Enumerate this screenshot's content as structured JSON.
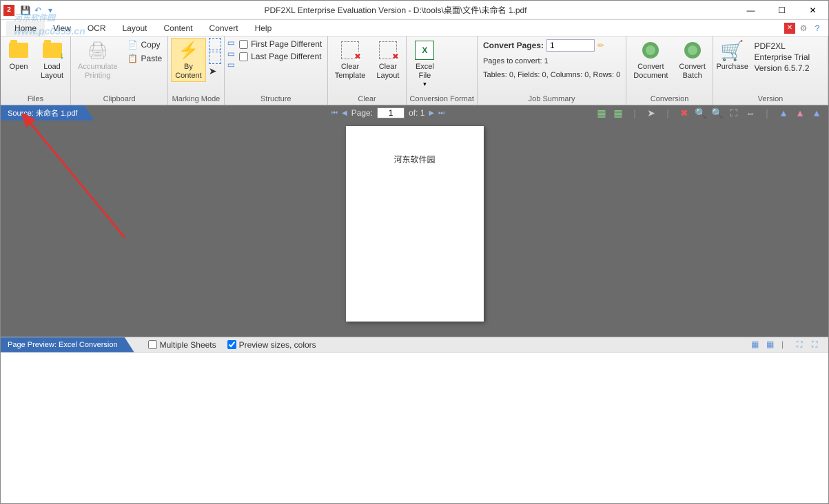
{
  "window": {
    "title": "PDF2XL Enterprise Evaluation Version - D:\\tools\\桌面\\文件\\未命名 1.pdf"
  },
  "menu": {
    "items": [
      "Home",
      "View",
      "OCR",
      "Layout",
      "Content",
      "Convert",
      "Help"
    ]
  },
  "ribbon": {
    "files": {
      "label": "Files",
      "open": "Open",
      "load_layout": "Load\nLayout"
    },
    "clipboard": {
      "label": "Clipboard",
      "accumulate": "Accumulate\nPrinting",
      "copy": "Copy",
      "paste": "Paste"
    },
    "marking": {
      "label": "Marking Mode",
      "by_content": "By\nContent"
    },
    "structure": {
      "label": "Structure",
      "first_page": "First Page Different",
      "last_page": "Last Page Different"
    },
    "clear": {
      "label": "Clear",
      "clear_template": "Clear\nTemplate",
      "clear_layout": "Clear\nLayout"
    },
    "conv_format": {
      "label": "Conversion Format",
      "excel_file": "Excel\nFile"
    },
    "job": {
      "label": "Job Summary",
      "convert_pages": "Convert Pages:",
      "convert_pages_value": "1",
      "pages_to_convert": "Pages to convert: 1",
      "counts": "Tables: 0, Fields: 0, Columns: 0, Rows: 0"
    },
    "conversion": {
      "label": "Conversion",
      "convert_doc": "Convert\nDocument",
      "convert_batch": "Convert\nBatch"
    },
    "version": {
      "label": "Version",
      "purchase": "Purchase",
      "text1": "PDF2XL Enterprise Trial",
      "text2": "Version 6.5.7.2"
    }
  },
  "source": {
    "label": "Source: 未命名 1.pdf"
  },
  "page_nav": {
    "page_label": "Page:",
    "page_value": "1",
    "of_label": "of: 1"
  },
  "document": {
    "page_text": "河东软件园"
  },
  "preview": {
    "tab": "Page Preview: Excel Conversion",
    "multiple_sheets": "Multiple Sheets",
    "preview_sizes": "Preview sizes, colors"
  },
  "watermark": {
    "text": "河东软件园",
    "url": "www.pc0359.cn"
  }
}
